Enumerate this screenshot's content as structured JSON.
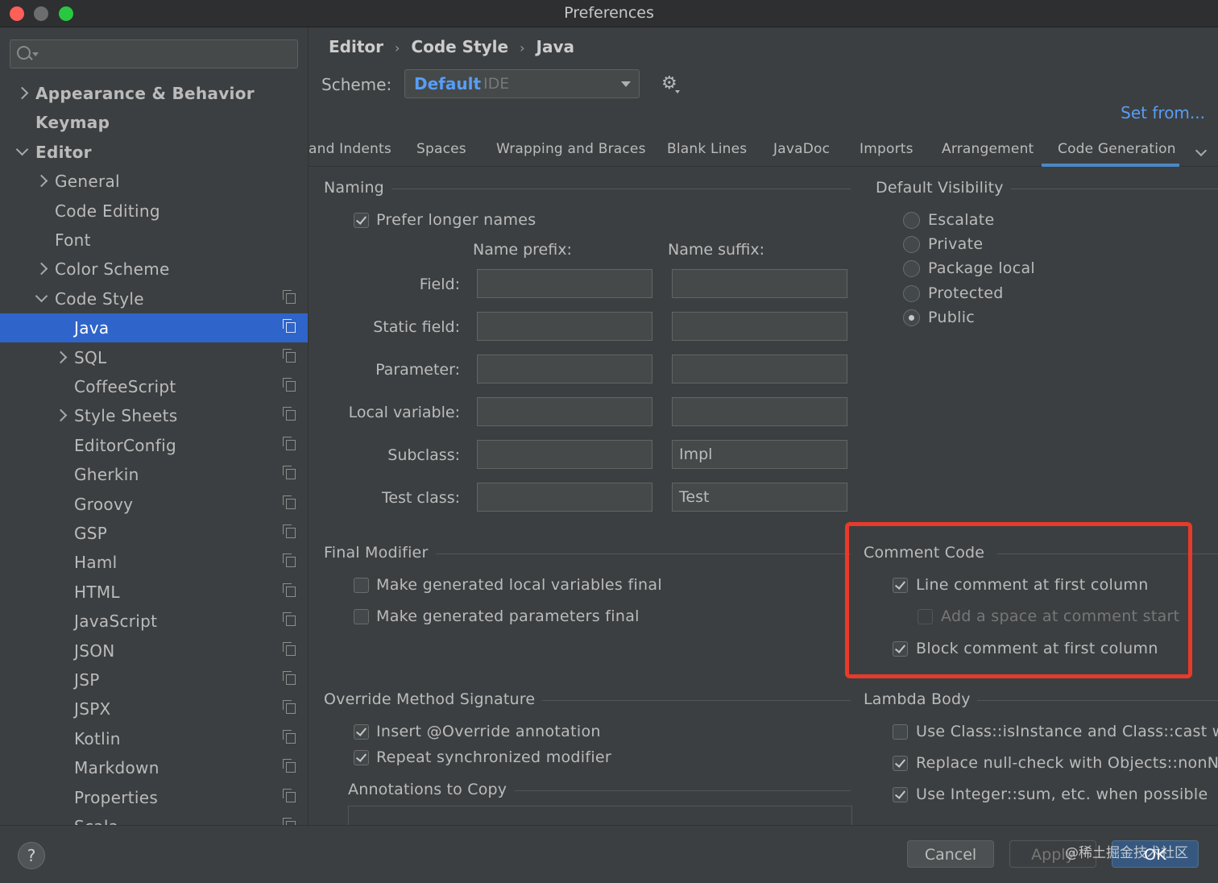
{
  "window": {
    "title": "Preferences"
  },
  "sidebar": {
    "search_placeholder": "",
    "items": [
      {
        "label": "Appearance & Behavior",
        "level": 0,
        "chevron": "right",
        "bold": true,
        "copy": false,
        "selected": false
      },
      {
        "label": "Keymap",
        "level": 0,
        "chevron": "",
        "bold": true,
        "copy": false,
        "selected": false
      },
      {
        "label": "Editor",
        "level": 0,
        "chevron": "down",
        "bold": true,
        "copy": false,
        "selected": false
      },
      {
        "label": "General",
        "level": 1,
        "chevron": "right",
        "bold": false,
        "copy": false,
        "selected": false
      },
      {
        "label": "Code Editing",
        "level": 1,
        "chevron": "",
        "bold": false,
        "copy": false,
        "selected": false
      },
      {
        "label": "Font",
        "level": 1,
        "chevron": "",
        "bold": false,
        "copy": false,
        "selected": false
      },
      {
        "label": "Color Scheme",
        "level": 1,
        "chevron": "right",
        "bold": false,
        "copy": false,
        "selected": false
      },
      {
        "label": "Code Style",
        "level": 1,
        "chevron": "down",
        "bold": false,
        "copy": true,
        "selected": false
      },
      {
        "label": "Java",
        "level": 2,
        "chevron": "",
        "bold": false,
        "copy": true,
        "selected": true
      },
      {
        "label": "SQL",
        "level": 2,
        "chevron": "right",
        "bold": false,
        "copy": true,
        "selected": false
      },
      {
        "label": "CoffeeScript",
        "level": 2,
        "chevron": "",
        "bold": false,
        "copy": true,
        "selected": false
      },
      {
        "label": "Style Sheets",
        "level": 2,
        "chevron": "right",
        "bold": false,
        "copy": true,
        "selected": false
      },
      {
        "label": "EditorConfig",
        "level": 2,
        "chevron": "",
        "bold": false,
        "copy": true,
        "selected": false
      },
      {
        "label": "Gherkin",
        "level": 2,
        "chevron": "",
        "bold": false,
        "copy": true,
        "selected": false
      },
      {
        "label": "Groovy",
        "level": 2,
        "chevron": "",
        "bold": false,
        "copy": true,
        "selected": false
      },
      {
        "label": "GSP",
        "level": 2,
        "chevron": "",
        "bold": false,
        "copy": true,
        "selected": false
      },
      {
        "label": "Haml",
        "level": 2,
        "chevron": "",
        "bold": false,
        "copy": true,
        "selected": false
      },
      {
        "label": "HTML",
        "level": 2,
        "chevron": "",
        "bold": false,
        "copy": true,
        "selected": false
      },
      {
        "label": "JavaScript",
        "level": 2,
        "chevron": "",
        "bold": false,
        "copy": true,
        "selected": false
      },
      {
        "label": "JSON",
        "level": 2,
        "chevron": "",
        "bold": false,
        "copy": true,
        "selected": false
      },
      {
        "label": "JSP",
        "level": 2,
        "chevron": "",
        "bold": false,
        "copy": true,
        "selected": false
      },
      {
        "label": "JSPX",
        "level": 2,
        "chevron": "",
        "bold": false,
        "copy": true,
        "selected": false
      },
      {
        "label": "Kotlin",
        "level": 2,
        "chevron": "",
        "bold": false,
        "copy": true,
        "selected": false
      },
      {
        "label": "Markdown",
        "level": 2,
        "chevron": "",
        "bold": false,
        "copy": true,
        "selected": false
      },
      {
        "label": "Properties",
        "level": 2,
        "chevron": "",
        "bold": false,
        "copy": true,
        "selected": false
      },
      {
        "label": "Scala",
        "level": 2,
        "chevron": "",
        "bold": false,
        "copy": true,
        "selected": false
      }
    ]
  },
  "breadcrumb": {
    "items": [
      "Editor",
      "Code Style",
      "Java"
    ],
    "separator": "›"
  },
  "scheme": {
    "label": "Scheme:",
    "value": "Default",
    "sub": "IDE"
  },
  "set_from": "Set from...",
  "tabs": [
    "and Indents",
    "Spaces",
    "Wrapping and Braces",
    "Blank Lines",
    "JavaDoc",
    "Imports",
    "Arrangement",
    "Code Generation"
  ],
  "active_tab": "Code Generation",
  "naming": {
    "title": "Naming",
    "prefer_longer": "Prefer longer names",
    "prefer_longer_checked": true,
    "prefix_header": "Name prefix:",
    "suffix_header": "Name suffix:",
    "rows": [
      {
        "label": "Field:",
        "prefix": "",
        "suffix": ""
      },
      {
        "label": "Static field:",
        "prefix": "",
        "suffix": ""
      },
      {
        "label": "Parameter:",
        "prefix": "",
        "suffix": ""
      },
      {
        "label": "Local variable:",
        "prefix": "",
        "suffix": ""
      },
      {
        "label": "Subclass:",
        "prefix": "",
        "suffix": "Impl"
      },
      {
        "label": "Test class:",
        "prefix": "",
        "suffix": "Test"
      }
    ]
  },
  "default_visibility": {
    "title": "Default Visibility",
    "options": [
      "Escalate",
      "Private",
      "Package local",
      "Protected",
      "Public"
    ],
    "selected": "Public"
  },
  "final_modifier": {
    "title": "Final Modifier",
    "local_vars": "Make generated local variables final",
    "local_vars_checked": false,
    "params": "Make generated parameters final",
    "params_checked": false
  },
  "comment_code": {
    "title": "Comment Code",
    "line_first_col": "Line comment at first column",
    "line_first_col_checked": true,
    "add_space": "Add a space at comment start",
    "add_space_checked": false,
    "block_first_col": "Block comment at first column",
    "block_first_col_checked": true,
    "highlight_color": "#e83a2a"
  },
  "override": {
    "title": "Override Method Signature",
    "insert_override": "Insert @Override annotation",
    "insert_override_checked": true,
    "repeat_sync": "Repeat synchronized modifier",
    "repeat_sync_checked": true,
    "annotations_title": "Annotations to Copy"
  },
  "lambda": {
    "title": "Lambda Body",
    "use_class": "Use Class::isInstance and Class::cast w",
    "use_class_checked": false,
    "replace_null": "Replace null-check with Objects::nonN",
    "replace_null_checked": true,
    "use_integer": "Use Integer::sum, etc. when possible",
    "use_integer_checked": true
  },
  "footer": {
    "help": "?",
    "cancel": "Cancel",
    "apply": "Apply",
    "ok": "OK",
    "watermark": "@稀土掘金技术社区"
  },
  "colors": {
    "accent": "#589df6",
    "selection": "#2f65ca",
    "background": "#3c3f41"
  }
}
